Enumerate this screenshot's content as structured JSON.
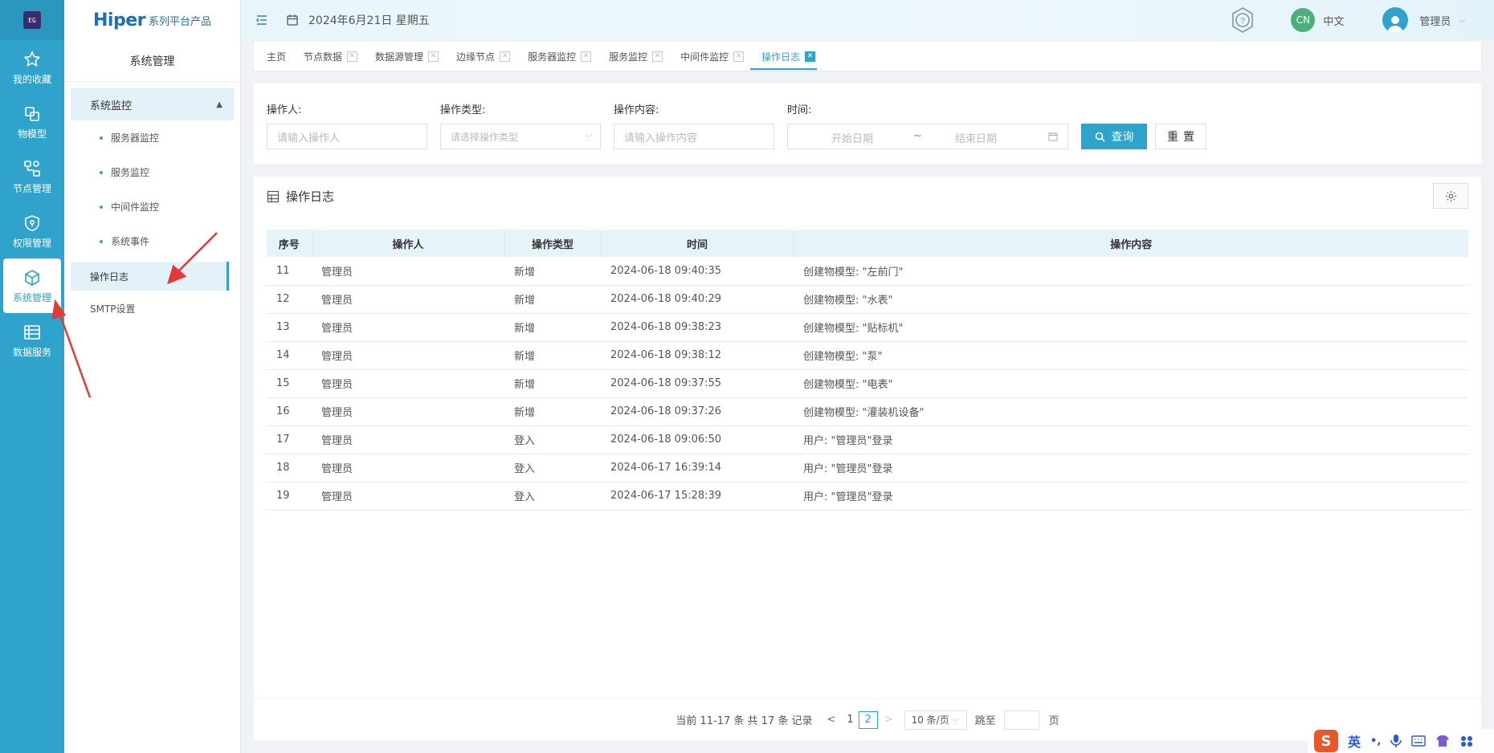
{
  "rail": {
    "logo_text": "EG",
    "items": [
      {
        "label": "我的收藏",
        "icon": "star-icon"
      },
      {
        "label": "物模型",
        "icon": "model-icon"
      },
      {
        "label": "节点管理",
        "icon": "node-icon"
      },
      {
        "label": "权限管理",
        "icon": "shield-icon"
      },
      {
        "label": "系统管理",
        "icon": "cube-icon",
        "active": true
      },
      {
        "label": "数据服务",
        "icon": "data-icon"
      }
    ]
  },
  "brand": {
    "main": "Hiper",
    "sub": "系列平台产品"
  },
  "subnav": {
    "section_title": "系统管理",
    "group_label": "系统监控",
    "group_items": [
      "服务器监控",
      "服务监控",
      "中间件监控",
      "系统事件"
    ],
    "top_items": [
      {
        "label": "操作日志",
        "active": true
      },
      {
        "label": "SMTP设置",
        "active": false
      }
    ]
  },
  "header": {
    "date": "2024年6月21日 星期五",
    "lang_code": "CN",
    "lang_label": "中文",
    "user_name": "管理员"
  },
  "tabs": [
    {
      "label": "主页",
      "closable": false
    },
    {
      "label": "节点数据",
      "closable": true
    },
    {
      "label": "数据源管理",
      "closable": true
    },
    {
      "label": "边缘节点",
      "closable": true
    },
    {
      "label": "服务器监控",
      "closable": true
    },
    {
      "label": "服务监控",
      "closable": true
    },
    {
      "label": "中间件监控",
      "closable": true
    },
    {
      "label": "操作日志",
      "closable": true,
      "active": true
    }
  ],
  "filters": {
    "operator_label": "操作人:",
    "operator_placeholder": "请输入操作人",
    "type_label": "操作类型:",
    "type_placeholder": "请选择操作类型",
    "content_label": "操作内容:",
    "content_placeholder": "请输入操作内容",
    "time_label": "时间:",
    "start_placeholder": "开始日期",
    "range_sep": "~",
    "end_placeholder": "结束日期",
    "query_label": "查询",
    "reset_label": "重置"
  },
  "table_panel": {
    "title": "操作日志",
    "columns": [
      "序号",
      "操作人",
      "操作类型",
      "时间",
      "操作内容"
    ],
    "rows": [
      [
        "11",
        "管理员",
        "新增",
        "2024-06-18 09:40:35",
        "创建物模型: \"左前门\""
      ],
      [
        "12",
        "管理员",
        "新增",
        "2024-06-18 09:40:29",
        "创建物模型: \"水表\""
      ],
      [
        "13",
        "管理员",
        "新增",
        "2024-06-18 09:38:23",
        "创建物模型: \"贴标机\""
      ],
      [
        "14",
        "管理员",
        "新增",
        "2024-06-18 09:38:12",
        "创建物模型: \"泵\""
      ],
      [
        "15",
        "管理员",
        "新增",
        "2024-06-18 09:37:55",
        "创建物模型: \"电表\""
      ],
      [
        "16",
        "管理员",
        "新增",
        "2024-06-18 09:37:26",
        "创建物模型: \"灌装机设备\""
      ],
      [
        "17",
        "管理员",
        "登入",
        "2024-06-18 09:06:50",
        "用户: \"管理员\"登录"
      ],
      [
        "18",
        "管理员",
        "登入",
        "2024-06-17 16:39:14",
        "用户: \"管理员\"登录"
      ],
      [
        "19",
        "管理员",
        "登入",
        "2024-06-17 15:28:39",
        "用户: \"管理员\"登录"
      ]
    ]
  },
  "pagination": {
    "summary": "当前 11-17 条 共 17 条 记录",
    "prev": "<",
    "page1": "1",
    "current": "2",
    "next": ">",
    "page_size": "10 条/页",
    "jump_label": "跳至",
    "page_unit": "页"
  },
  "ime": {
    "logo": "S",
    "mode": "英"
  },
  "colors": {
    "accent": "#2fa3cc",
    "annotation": "#e53935"
  }
}
